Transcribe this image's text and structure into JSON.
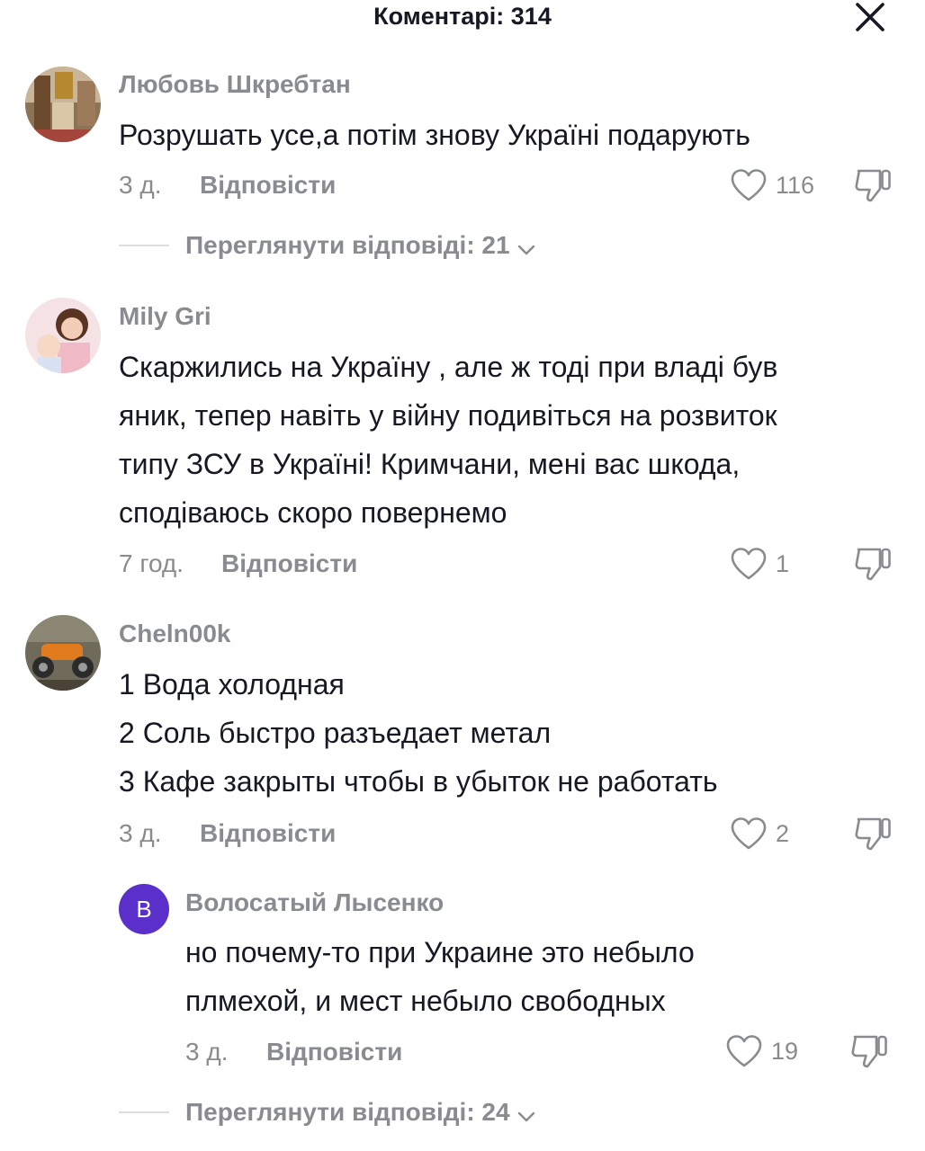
{
  "header": {
    "title": "Коментарі: 314",
    "close_icon": "close-icon"
  },
  "comments": [
    {
      "username": "Любовь Шкребтан",
      "lines": [
        "Розрушать усе,а потім знову Україні подарують"
      ],
      "time": "3 д.",
      "reply_label": "Відповісти",
      "likes": "116",
      "view_replies": "Переглянути відповіді: 21"
    },
    {
      "username": "Mily Gri",
      "lines": [
        "Скаржились на Україну , але ж тоді при владі був",
        "яник, тепер навіть у війну подивіться на розвиток",
        "типу ЗСУ в Україні! Кримчани, мені вас шкода,",
        "сподіваюсь скоро повернемо"
      ],
      "time": "7 год.",
      "reply_label": "Відповісти",
      "likes": "1"
    },
    {
      "username": "Cheln00k",
      "lines": [
        "1 Вода холодная",
        "2 Соль быстро разъедает метал",
        "3 Кафе закрыты чтобы в убыток не работать"
      ],
      "time": "3 д.",
      "reply_label": "Відповісти",
      "likes": "2",
      "reply": {
        "avatar_letter": "В",
        "avatar_color": "#5b2fc9",
        "username": "Волосатый Лысенко",
        "lines": [
          "но почему-то при Украине это небыло",
          "плмехой, и мест небыло свободных"
        ],
        "time": "3 д.",
        "reply_label": "Відповісти",
        "likes": "19"
      },
      "view_replies": "Переглянути відповіді: 24"
    }
  ]
}
